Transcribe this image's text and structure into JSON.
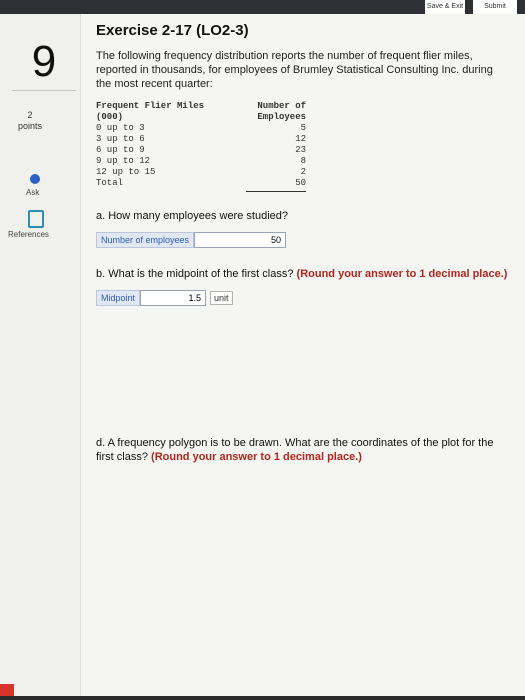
{
  "topbar": {
    "save_label": "Save & Exit",
    "submit_label": "Submit"
  },
  "left": {
    "question_number": "9",
    "points_value": "2",
    "points_label": "points",
    "ask_label": "Ask",
    "references_label": "References"
  },
  "exercise": {
    "title": "Exercise 2-17 (LO2-3)",
    "intro": "The following frequency distribution reports the number of frequent flier miles, reported in thousands, for employees of Brumley Statistical Consulting Inc. during the most recent quarter:"
  },
  "table": {
    "headers": [
      "Frequent Flier Miles (000)",
      "Number of Employees"
    ],
    "rows": [
      [
        "0 up to 3",
        "5"
      ],
      [
        "3 up to 6",
        "12"
      ],
      [
        "6 up to 9",
        "23"
      ],
      [
        "9 up to 12",
        "8"
      ],
      [
        "12 up to 15",
        "2"
      ]
    ],
    "total_label": "Total",
    "total_value": "50"
  },
  "questions": {
    "a": "a. How many employees were studied?",
    "a_label": "Number of employees",
    "a_value": "50",
    "b_prefix": "b. What is the midpoint of the first class?",
    "b_instruction": "(Round your answer to 1 decimal place.)",
    "b_label": "Midpoint",
    "b_value": "1.5",
    "b_unit": "unit",
    "d_prefix": "d. A frequency polygon is to be drawn. What are the coordinates of the plot for the first class?",
    "d_instruction": "(Round your answer to 1 decimal place.)"
  },
  "colors": {
    "accent": "#2b60c9",
    "instruction_red": "#b3261e"
  }
}
